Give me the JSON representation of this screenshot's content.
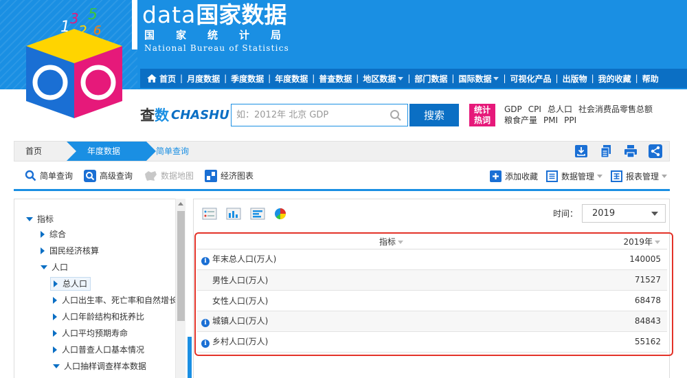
{
  "brand": {
    "title_latin": "data",
    "title_cn": "国家数据",
    "subtitle": "国家统计局",
    "subtitle_en": "National Bureau of Statistics"
  },
  "nav": {
    "items": [
      {
        "label": "首页",
        "icon": "home-icon"
      },
      {
        "label": "月度数据"
      },
      {
        "label": "季度数据"
      },
      {
        "label": "年度数据"
      },
      {
        "label": "普查数据"
      },
      {
        "label": "地区数据",
        "dropdown": true
      },
      {
        "label": "部门数据"
      },
      {
        "label": "国际数据",
        "dropdown": true
      },
      {
        "label": "可视化产品"
      },
      {
        "label": "出版物"
      },
      {
        "label": "我的收藏"
      },
      {
        "label": "帮助"
      }
    ]
  },
  "search": {
    "logo_cha": "查",
    "logo_shu": "数",
    "logo_en": "CHASHU",
    "placeholder": "如：2012年 北京 GDP",
    "button": "搜索",
    "hot_badge_line1": "统计",
    "hot_badge_line2": "热词",
    "hot_words": [
      "GDP",
      "CPI",
      "总人口",
      "社会消费品零售总额",
      "粮食产量",
      "PMI",
      "PPI"
    ]
  },
  "breadcrumb": {
    "home": "首页",
    "section": "年度数据",
    "current": "简单查询"
  },
  "toolbar": {
    "simple_query": "简单查询",
    "advanced_query": "高级查询",
    "data_map": "数据地图",
    "econ_chart": "经济图表",
    "add_favorite": "添加收藏",
    "data_manage": "数据管理",
    "report_manage": "报表管理"
  },
  "tree": {
    "root": "指标",
    "items": [
      {
        "label": "综合",
        "level": 1,
        "state": "collapsed"
      },
      {
        "label": "国民经济核算",
        "level": 1,
        "state": "collapsed"
      },
      {
        "label": "人口",
        "level": 1,
        "state": "expanded"
      },
      {
        "label": "总人口",
        "level": 2,
        "state": "collapsed",
        "selected": true
      },
      {
        "label": "人口出生率、死亡率和自然增长率",
        "level": 2,
        "state": "collapsed"
      },
      {
        "label": "人口年龄结构和抚养比",
        "level": 2,
        "state": "collapsed"
      },
      {
        "label": "人口平均预期寿命",
        "level": 2,
        "state": "collapsed"
      },
      {
        "label": "人口普查人口基本情况",
        "level": 2,
        "state": "collapsed"
      },
      {
        "label": "人口抽样调查样本数据",
        "level": 2,
        "state": "expanded"
      }
    ]
  },
  "main": {
    "time_label": "时间：",
    "time_value": "2019",
    "table": {
      "col_indicator": "指标",
      "col_year": "2019年",
      "rows": [
        {
          "name": "年末总人口(万人)",
          "value": "140005",
          "info": true
        },
        {
          "name": "男性人口(万人)",
          "value": "71527",
          "info": false
        },
        {
          "name": "女性人口(万人)",
          "value": "68478",
          "info": false
        },
        {
          "name": "城镇人口(万人)",
          "value": "84843",
          "info": true
        },
        {
          "name": "乡村人口(万人)",
          "value": "55162",
          "info": true
        }
      ]
    }
  },
  "colors": {
    "brand_blue": "#1a8fe3",
    "nav_blue": "#0b6fc4",
    "hot_pink": "#e6197a",
    "highlight_red": "#e33228"
  }
}
